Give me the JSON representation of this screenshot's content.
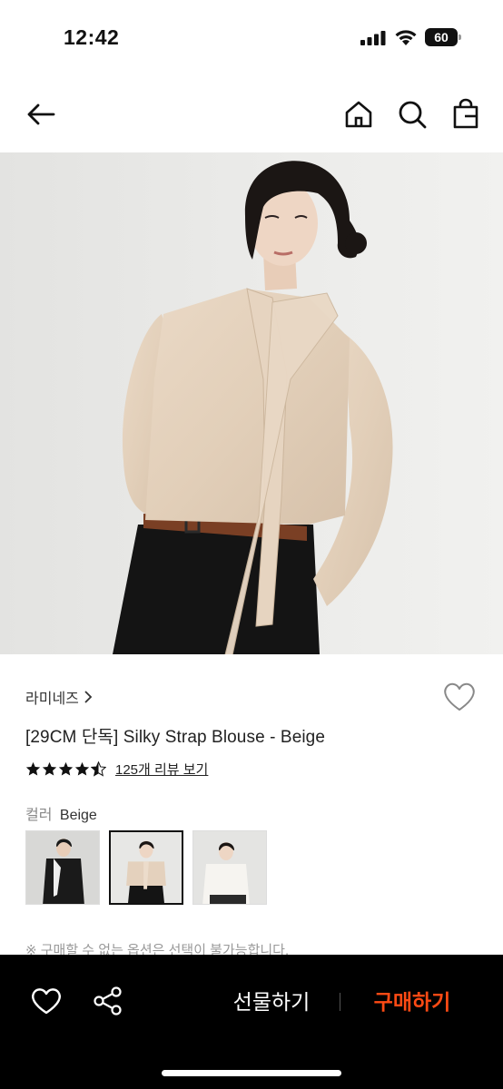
{
  "status_bar": {
    "time": "12:42",
    "battery": "60"
  },
  "nav": {
    "back_icon": "arrow-left-icon",
    "home_icon": "home-icon",
    "search_icon": "search-icon",
    "bag_icon": "shopping-bag-icon"
  },
  "product": {
    "image_desc": "model-wearing-beige-blouse",
    "brand": "라미네즈",
    "title": "[29CM 단독] Silky Strap Blouse - Beige",
    "rating": 4.5,
    "review_label": "125개 리뷰 보기",
    "color_label": "컬러",
    "color_value": "Beige",
    "thumbnails": [
      "black",
      "beige",
      "white"
    ],
    "selected_thumbnail": 1,
    "notice": "※ 구매할 수 없는 옵션은 선택이 불가능합니다."
  },
  "bottom_bar": {
    "gift_label": "선물하기",
    "buy_label": "구매하기",
    "buy_color": "#ff4a14"
  }
}
